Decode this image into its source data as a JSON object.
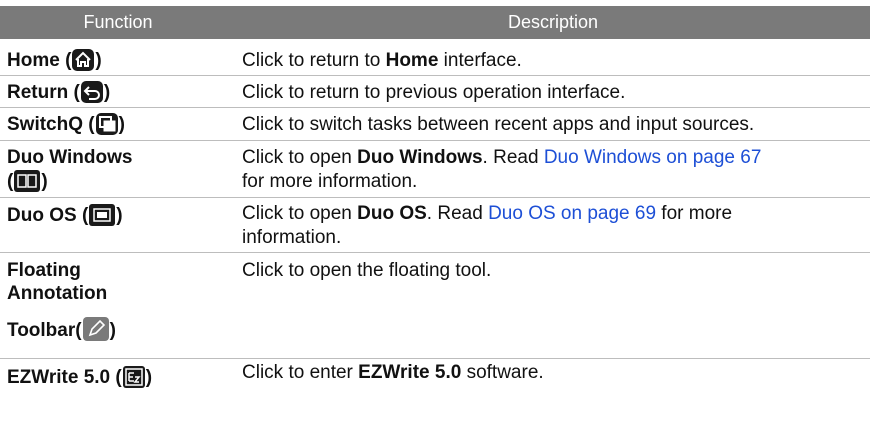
{
  "header": {
    "function": "Function",
    "description": "Description"
  },
  "rows": [
    {
      "name": "Home (",
      "close": ")",
      "icon": "home-icon",
      "desc_pre": "Click to return to ",
      "desc_bold": "Home",
      "desc_post": " interface."
    },
    {
      "name": "Return (",
      "close": ")",
      "icon": "return-icon",
      "desc": "Click to return to previous operation interface."
    },
    {
      "name": "SwitchQ (",
      "close": ")",
      "icon": "switchq-icon",
      "desc": "Click to switch tasks between recent apps and input sources."
    },
    {
      "name": "Duo Windows",
      "name2_open": "(",
      "close": ")",
      "icon": "duo-windows-icon",
      "desc_pre": "Click to open ",
      "desc_bold": "Duo Windows",
      "desc_mid": ". Read ",
      "link": "Duo Windows on page 67",
      "desc_post_line2": "for more information."
    },
    {
      "name": "Duo OS (",
      "close": ")",
      "icon": "duo-os-icon",
      "desc_pre": "Click to open ",
      "desc_bold": "Duo OS",
      "desc_mid": ". Read ",
      "link": "Duo OS on page 69",
      "desc_post": " for more",
      "desc_line2": "information."
    },
    {
      "name_l1": "Floating",
      "name_l2": "Annotation",
      "name_l3": "Toolbar(",
      "close": ")",
      "icon": "pen-icon",
      "desc": "Click to open the floating tool."
    },
    {
      "name": "EZWrite 5.0 (",
      "close": ")",
      "icon": "ezwrite-icon",
      "desc_pre": "Click to enter ",
      "desc_bold": "EZWrite 5.0",
      "desc_post": " software."
    }
  ]
}
